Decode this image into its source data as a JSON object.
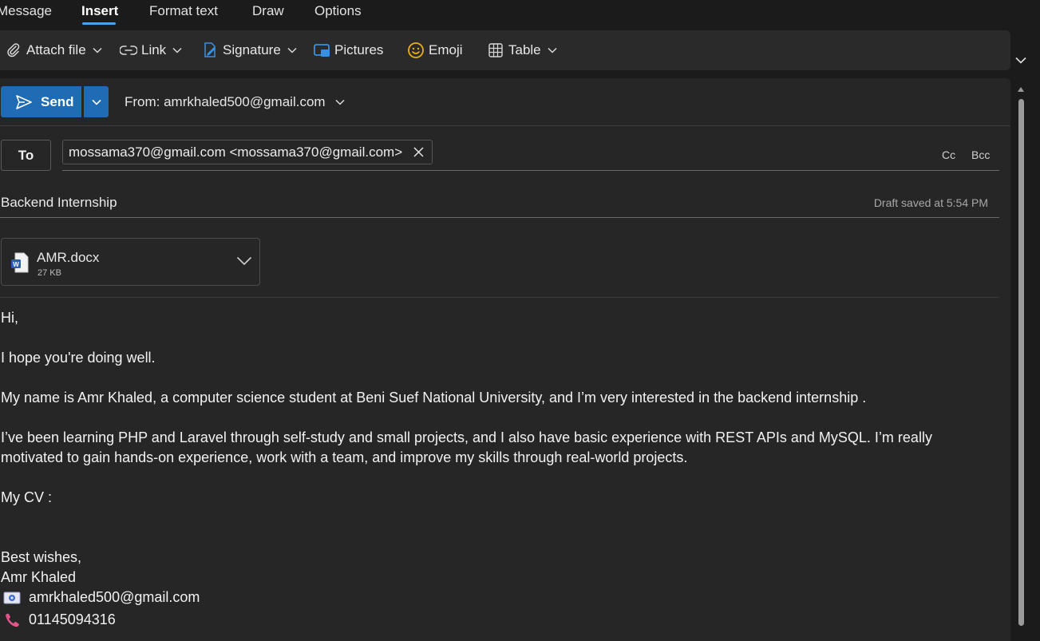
{
  "tabs": [
    {
      "label": "Message"
    },
    {
      "label": "Insert",
      "active": true
    },
    {
      "label": "Format text"
    },
    {
      "label": "Draw"
    },
    {
      "label": "Options"
    }
  ],
  "ribbon": {
    "attach_file": "Attach file",
    "link": "Link",
    "signature": "Signature",
    "pictures": "Pictures",
    "emoji": "Emoji",
    "table": "Table"
  },
  "compose": {
    "send_label": "Send",
    "from_label": "From: amrkhaled500@gmail.com",
    "to_label": "To",
    "recipient": "mossama370@gmail.com <mossama370@gmail.com>",
    "cc_label": "Cc",
    "bcc_label": "Bcc",
    "subject": "Backend Internship",
    "draft_status": "Draft saved at 5:54 PM",
    "attachment": {
      "name": "AMR.docx",
      "size": "27 KB"
    }
  },
  "body": {
    "greeting": "Hi,",
    "line1": "I hope you're doing well.",
    "line2": "My name is Amr Khaled, a computer science student at Beni Suef National University, and I’m very interested in the backend internship .",
    "line3a": "I’ve been learning PHP and Laravel through self-study and small projects, and I also have basic experience with REST APIs and MySQL. I’m really",
    "line3b": "motivated to gain hands-on experience, work with a team, and improve my skills through real-world projects.",
    "cv_label": " My CV :",
    "closing": "Best wishes,",
    "name": "Amr Khaled",
    "email": "amrkhaled500@gmail.com",
    "phone": "01145094316"
  },
  "colors": {
    "accent": "#1f6cb5",
    "tab_underline": "#4ea3e6",
    "background": "#1b1b1b",
    "pane": "#262626",
    "emoji_yellow": "#e9b115",
    "pictures_blue": "#3b8fe0",
    "word_blue": "#2b5cb8",
    "phone_pink": "#e0558a"
  },
  "icons": [
    "paperclip-icon",
    "link-icon",
    "signature-icon",
    "pictures-icon",
    "emoji-icon",
    "table-icon",
    "send-icon",
    "close-icon",
    "word-file-icon",
    "email-icon",
    "phone-icon",
    "chevron-down-icon"
  ]
}
